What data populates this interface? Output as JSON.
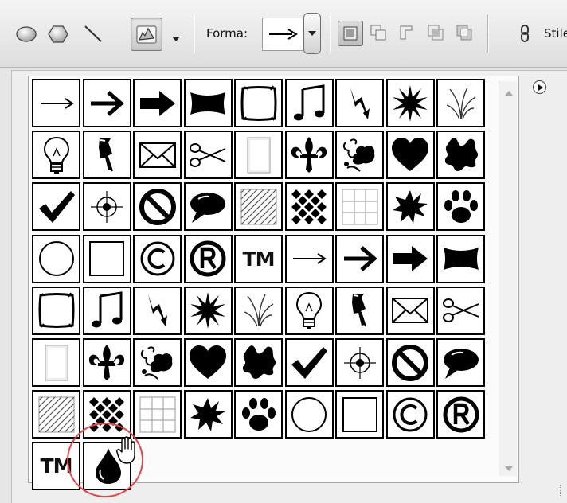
{
  "toolbar": {
    "forma_label": "Forma:",
    "stile_label": "Stile",
    "tools": [
      "ellipse-tool-icon",
      "polygon-tool-icon",
      "line-tool-icon",
      "custom-shape-tool-icon"
    ],
    "modes": [
      "new-layer-mode-icon",
      "add-mode-icon",
      "subtract-mode-icon",
      "intersect-mode-icon",
      "exclude-mode-icon"
    ]
  },
  "shapes": [
    {
      "icon": "arrow-thin-icon"
    },
    {
      "icon": "arrow-medium-icon"
    },
    {
      "icon": "arrow-bold-icon"
    },
    {
      "icon": "banner-icon"
    },
    {
      "icon": "frame-square-icon"
    },
    {
      "icon": "music-note-icon"
    },
    {
      "icon": "lightning-icon"
    },
    {
      "icon": "starburst-icon"
    },
    {
      "icon": "grass-icon"
    },
    {
      "icon": "lightbulb-icon"
    },
    {
      "icon": "thumbtack-icon"
    },
    {
      "icon": "envelope-icon"
    },
    {
      "icon": "scissors-icon"
    },
    {
      "icon": "blank-frame-icon"
    },
    {
      "icon": "fleur-de-lis-icon"
    },
    {
      "icon": "flower-ornament-icon"
    },
    {
      "icon": "heart-icon"
    },
    {
      "icon": "splat-icon"
    },
    {
      "icon": "checkmark-icon"
    },
    {
      "icon": "crosshair-icon"
    },
    {
      "icon": "no-sign-icon"
    },
    {
      "icon": "speech-bubble-icon"
    },
    {
      "icon": "hatched-square-icon"
    },
    {
      "icon": "checkerboard-icon"
    },
    {
      "icon": "grid-icon"
    },
    {
      "icon": "burst-icon"
    },
    {
      "icon": "paw-print-icon"
    },
    {
      "icon": "circle-icon"
    },
    {
      "icon": "square-icon"
    },
    {
      "icon": "copyright-icon"
    },
    {
      "icon": "registered-icon"
    },
    {
      "icon": "trademark-icon",
      "label": "TM"
    },
    {
      "icon": "arrow-thin-icon"
    },
    {
      "icon": "arrow-medium-icon"
    },
    {
      "icon": "arrow-bold-icon"
    },
    {
      "icon": "banner-icon"
    },
    {
      "icon": "frame-square-icon"
    },
    {
      "icon": "music-note-icon"
    },
    {
      "icon": "lightning-icon"
    },
    {
      "icon": "starburst-icon"
    },
    {
      "icon": "grass-icon"
    },
    {
      "icon": "lightbulb-icon"
    },
    {
      "icon": "thumbtack-icon"
    },
    {
      "icon": "envelope-icon"
    },
    {
      "icon": "scissors-icon"
    },
    {
      "icon": "blank-frame-icon"
    },
    {
      "icon": "fleur-de-lis-icon"
    },
    {
      "icon": "flower-ornament-icon"
    },
    {
      "icon": "heart-icon"
    },
    {
      "icon": "splat-icon"
    },
    {
      "icon": "checkmark-icon"
    },
    {
      "icon": "crosshair-icon"
    },
    {
      "icon": "no-sign-icon"
    },
    {
      "icon": "speech-bubble-icon"
    },
    {
      "icon": "hatched-square-icon"
    },
    {
      "icon": "checkerboard-icon"
    },
    {
      "icon": "grid-icon"
    },
    {
      "icon": "burst-icon"
    },
    {
      "icon": "paw-print-icon"
    },
    {
      "icon": "circle-icon"
    },
    {
      "icon": "square-icon"
    },
    {
      "icon": "copyright-icon"
    },
    {
      "icon": "registered-icon"
    },
    {
      "icon": "trademark-icon",
      "label": "TM"
    },
    {
      "icon": "droplet-icon"
    }
  ],
  "colors": {
    "highlight_ring": "#e2464b"
  }
}
